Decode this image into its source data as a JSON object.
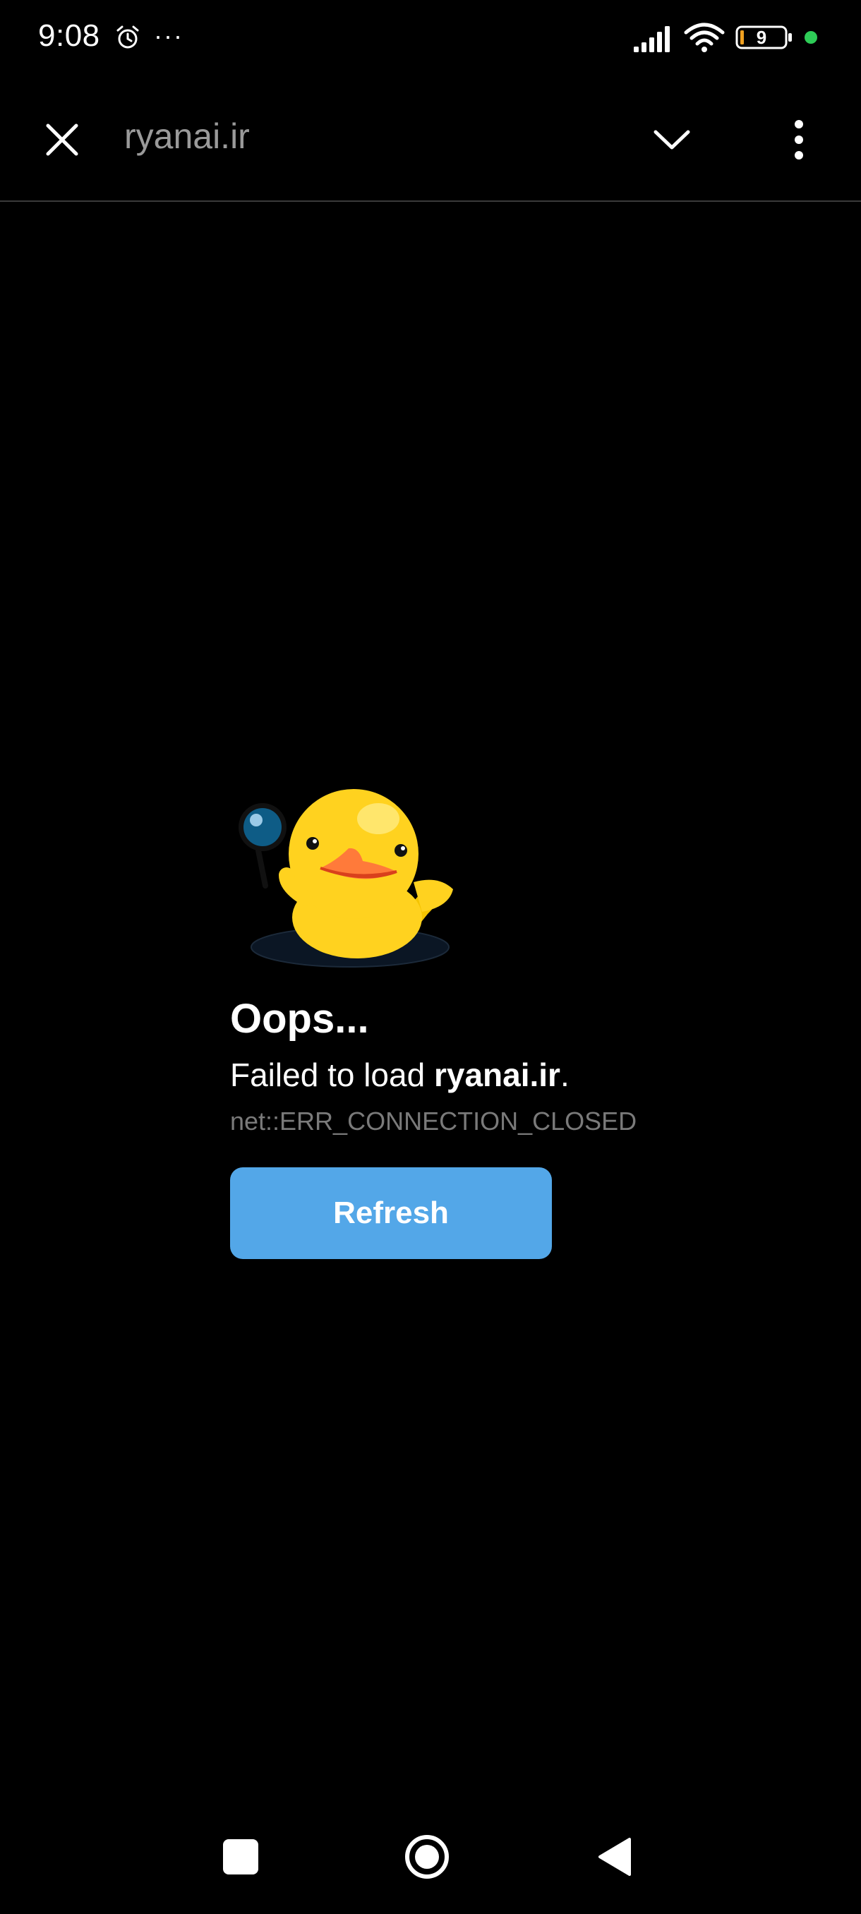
{
  "status_bar": {
    "time": "9:08",
    "more_indicator": "···",
    "battery_level": "9",
    "icons": [
      "alarm-icon",
      "signal-icon",
      "wifi-icon",
      "battery-icon",
      "camera-in-use-dot"
    ]
  },
  "top_bar": {
    "url": "ryanai.ir",
    "icons": [
      "close-icon",
      "chevron-down-icon",
      "more-vertical-icon"
    ]
  },
  "error": {
    "illustration": "duck-with-magnifier",
    "title": "Oops...",
    "message_prefix": "Failed to load ",
    "message_domain": "ryanai.ir",
    "message_suffix": ".",
    "code": "net::ERR_CONNECTION_CLOSED",
    "refresh_label": "Refresh"
  },
  "nav_bar": {
    "icons": [
      "recents-icon",
      "home-icon",
      "back-icon"
    ]
  },
  "colors": {
    "background": "#000000",
    "accent": "#53a7e8",
    "muted_text": "#7a7a7a",
    "url_text": "#9a9a9a",
    "status_dot": "#2ecc57"
  }
}
